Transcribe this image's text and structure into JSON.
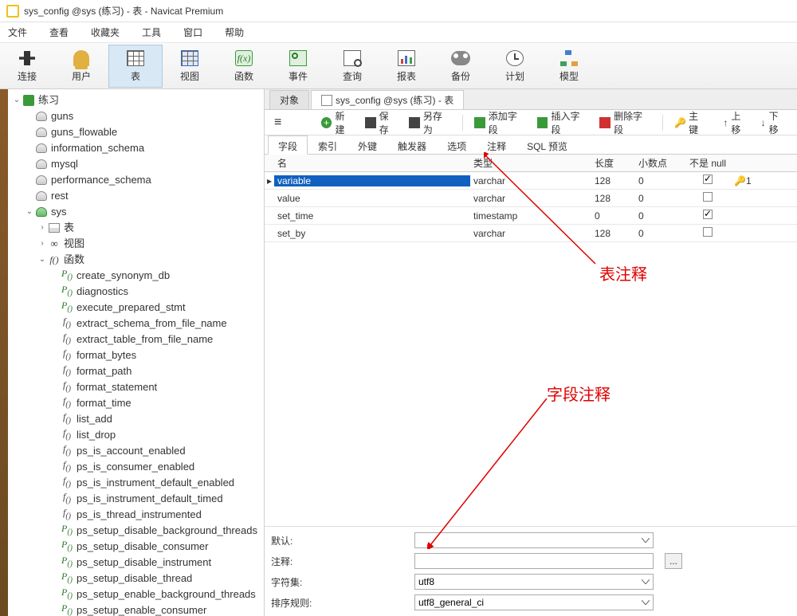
{
  "title": "sys_config @sys (练习) - 表 - Navicat Premium",
  "menubar": [
    "文件",
    "查看",
    "收藏夹",
    "工具",
    "窗口",
    "帮助"
  ],
  "bigtoolbar": [
    {
      "label": "连接",
      "icon": "plug"
    },
    {
      "label": "用户",
      "icon": "user"
    },
    {
      "label": "表",
      "icon": "grid",
      "active": true
    },
    {
      "label": "视图",
      "icon": "grid_b"
    },
    {
      "label": "函数",
      "icon": "fx"
    },
    {
      "label": "事件",
      "icon": "event"
    },
    {
      "label": "查询",
      "icon": "query"
    },
    {
      "label": "报表",
      "icon": "report"
    },
    {
      "label": "备份",
      "icon": "backup"
    },
    {
      "label": "计划",
      "icon": "sched"
    },
    {
      "label": "模型",
      "icon": "model"
    }
  ],
  "tree": {
    "root": {
      "label": "练习"
    },
    "dbs": [
      "guns",
      "guns_flowable",
      "information_schema",
      "mysql",
      "performance_schema",
      "rest"
    ],
    "sys": {
      "label": "sys",
      "children": [
        {
          "label": "表",
          "icon": "table"
        },
        {
          "label": "视图",
          "icon": "view"
        },
        {
          "label": "函数",
          "icon": "fn",
          "expanded": true
        }
      ]
    },
    "procs": [
      "create_synonym_db",
      "diagnostics",
      "execute_prepared_stmt"
    ],
    "funcs": [
      "extract_schema_from_file_name",
      "extract_table_from_file_name",
      "format_bytes",
      "format_path",
      "format_statement",
      "format_time",
      "list_add",
      "list_drop",
      "ps_is_account_enabled",
      "ps_is_consumer_enabled",
      "ps_is_instrument_default_enabled",
      "ps_is_instrument_default_timed",
      "ps_is_thread_instrumented"
    ],
    "procs2": [
      "ps_setup_disable_background_threads",
      "ps_setup_disable_consumer",
      "ps_setup_disable_instrument",
      "ps_setup_disable_thread",
      "ps_setup_enable_background_threads",
      "ps_setup_enable_consumer"
    ]
  },
  "tabs": [
    {
      "label": "对象",
      "active": false
    },
    {
      "label": "sys_config @sys (练习) - 表",
      "active": true
    }
  ],
  "toolstrip": {
    "menu": "≡",
    "new": "新建",
    "save": "保存",
    "saveas": "另存为",
    "addfield": "添加字段",
    "insertfield": "插入字段",
    "deletefield": "删除字段",
    "primarykey": "主键",
    "moveup": "上移",
    "movedown": "下移"
  },
  "subtabs": [
    "字段",
    "索引",
    "外键",
    "触发器",
    "选项",
    "注释",
    "SQL 预览"
  ],
  "grid": {
    "headers": {
      "name": "名",
      "type": "类型",
      "len": "长度",
      "dec": "小数点",
      "null": "不是 null"
    },
    "rows": [
      {
        "name": "variable",
        "type": "varchar",
        "len": "128",
        "dec": "0",
        "notnull": true,
        "key": "1",
        "sel": true
      },
      {
        "name": "value",
        "type": "varchar",
        "len": "128",
        "dec": "0",
        "notnull": false
      },
      {
        "name": "set_time",
        "type": "timestamp",
        "len": "0",
        "dec": "0",
        "notnull": true
      },
      {
        "name": "set_by",
        "type": "varchar",
        "len": "128",
        "dec": "0",
        "notnull": false
      }
    ]
  },
  "form": {
    "default_lbl": "默认:",
    "default_val": "",
    "comment_lbl": "注释:",
    "comment_val": "",
    "charset_lbl": "字符集:",
    "charset_val": "utf8",
    "collation_lbl": "排序规则:",
    "collation_val": "utf8_general_ci"
  },
  "annotations": {
    "table_comment": "表注释",
    "field_comment": "字段注释"
  }
}
